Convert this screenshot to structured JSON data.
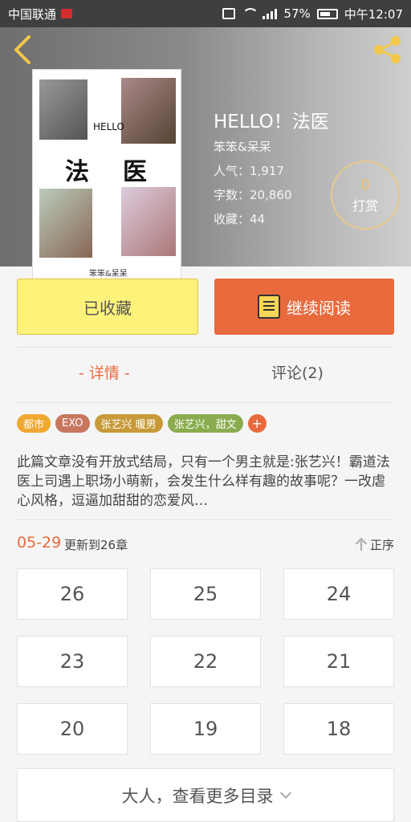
{
  "status_bar": {
    "carrier": "中国联通",
    "battery_percent": "57%",
    "time": "中午12:07"
  },
  "book": {
    "title": "HELLO！法医",
    "author": "笨笨&呆呆",
    "popularity": "人气：1,917",
    "word_count": "字数：20,860",
    "favorites": "收藏：44",
    "reward": {
      "count": "0",
      "label": "打赏"
    },
    "cover": {
      "hello": "HELLO",
      "char1": "法",
      "char2": "医",
      "author_mark": "笨笨&呆呆"
    }
  },
  "actions": {
    "collected_label": "已收藏",
    "continue_label": "继续阅读"
  },
  "tabs": {
    "detail": "- 详情 -",
    "comments": "评论(2)"
  },
  "tags": [
    {
      "label": "都市",
      "color": "#f0a830"
    },
    {
      "label": "EXO",
      "color": "#c8765e"
    },
    {
      "label": "张艺兴   暖男",
      "color": "#c89a3a"
    },
    {
      "label": "张艺兴，甜文",
      "color": "#8aac4e"
    }
  ],
  "description": "此篇文章没有开放式结局，只有一个男主就是:张艺兴！霸道法医上司遇上职场小萌新，会发生什么样有趣的故事呢？一改虐心风格，逗逼加甜甜的恋爱风…",
  "update": {
    "date": "05-29",
    "text": "更新到26章",
    "sort_label": "正序"
  },
  "chapters": [
    "26",
    "25",
    "24",
    "23",
    "22",
    "21",
    "20",
    "19",
    "18"
  ],
  "more_label": "大人，查看更多目录",
  "colors": {
    "accent": "#e86a3d",
    "collected_bg": "#fdf27a"
  }
}
